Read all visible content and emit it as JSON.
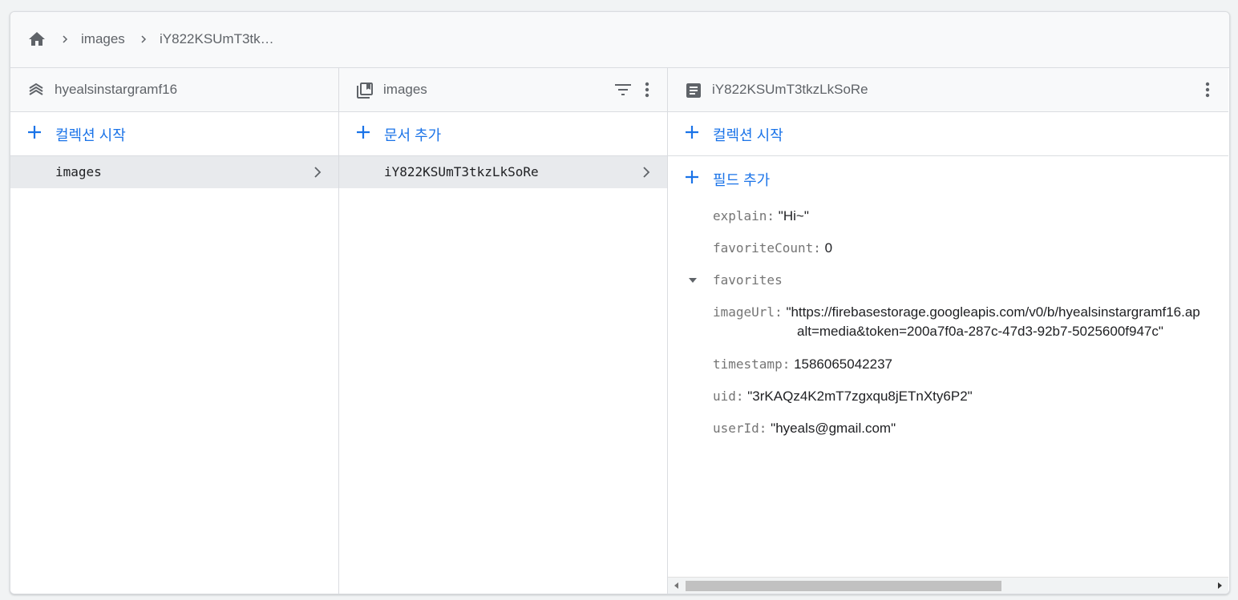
{
  "breadcrumb": {
    "home_icon": "home-icon",
    "items": [
      "images",
      "iY822KSUmT3tk…"
    ]
  },
  "panels": {
    "root": {
      "title": "hyealsinstargramf16",
      "icon": "database-icon",
      "add_label": "컬렉션 시작",
      "items": [
        "images"
      ]
    },
    "collection": {
      "title": "images",
      "icon": "collection-icon",
      "add_label": "문서 추가",
      "items": [
        "iY822KSUmT3tkzLkSoRe"
      ]
    },
    "document": {
      "title": "iY822KSUmT3tkzLkSoRe",
      "icon": "document-icon",
      "add_collection_label": "컬렉션 시작",
      "add_field_label": "필드 추가",
      "fields": [
        {
          "key": "explain:",
          "value": "\"Hi~\""
        },
        {
          "key": "favoriteCount:",
          "value": "0"
        },
        {
          "key": "favorites",
          "value": ""
        },
        {
          "key": "imageUrl:",
          "value": "\"https://firebasestorage.googleapis.com/v0/b/hyealsinstargramf16.ap",
          "value2": "alt=media&token=200a7f0a-287c-47d3-92b7-5025600f947c\""
        },
        {
          "key": "timestamp:",
          "value": "1586065042237"
        },
        {
          "key": "uid:",
          "value": "\"3rKAQz4K2mT7zgxqu8jETnXty6P2\""
        },
        {
          "key": "userId:",
          "value": "\"hyeals@gmail.com\""
        }
      ]
    }
  },
  "colors": {
    "accent": "#1a73e8",
    "text": "#202124",
    "muted": "#5f6368",
    "selected_row": "#e8eaed"
  }
}
